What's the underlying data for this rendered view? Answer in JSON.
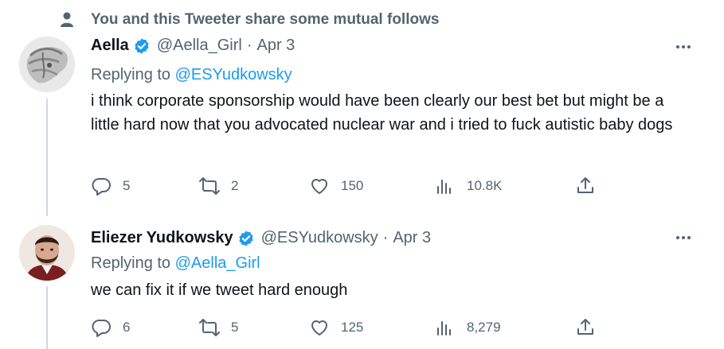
{
  "social_context": {
    "text": "You and this Tweeter share some mutual follows",
    "icon": "person-icon"
  },
  "tweets": [
    {
      "display_name": "Aella",
      "handle": "@Aella_Girl",
      "separator": "·",
      "date": "Apr 3",
      "replying_prefix": "Replying to",
      "replying_to": "@ESYudkowsky",
      "text": "i think corporate sponsorship would have been clearly our best bet but might be a little hard now that you advocated nuclear war and i tried to fuck autistic baby dogs",
      "replies": "5",
      "retweets": "2",
      "likes": "150",
      "views": "10.8K"
    },
    {
      "display_name": "Eliezer Yudkowsky",
      "handle": "@ESYudkowsky",
      "separator": "·",
      "date": "Apr 3",
      "replying_prefix": "Replying to",
      "replying_to": "@Aella_Girl",
      "text": "we can fix it if we tweet hard enough",
      "replies": "6",
      "retweets": "5",
      "likes": "125",
      "views": "8,279"
    }
  ],
  "colors": {
    "accent": "#1d9bf0",
    "muted": "#536471",
    "text": "#0f1419",
    "thread_line": "#cfd9de"
  }
}
